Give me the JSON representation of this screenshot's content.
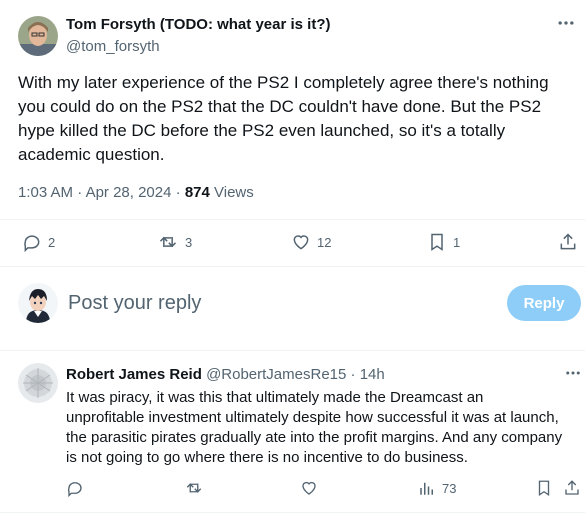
{
  "main_tweet": {
    "author_name": "Tom Forsyth (TODO: what year is it?)",
    "author_handle": "@tom_forsyth",
    "text_lines": [
      "With my later experience of the PS2 I completely agree there's nothing",
      "you could do on the PS2 that the DC couldn't have done. But the PS2",
      "hype killed the DC before the PS2 even launched, so it's a totally",
      "academic question."
    ],
    "time": "1:03 AM",
    "date": "Apr 28, 2024",
    "views_count": "874",
    "views_label": "Views",
    "separator": "·",
    "actions": {
      "replies": "2",
      "retweets": "3",
      "likes": "12",
      "bookmarks": "1"
    }
  },
  "composer": {
    "placeholder": "Post your reply",
    "button_label": "Reply"
  },
  "reply_tweet": {
    "author_name": "Robert James Reid",
    "author_handle": "@RobertJamesRe15",
    "separator": "·",
    "time": "14h",
    "text_lines": [
      "It was piracy, it was this that ultimately made the Dreamcast an",
      "unprofitable investment ultimately despite how successful it was at launch,",
      "the parasitic pirates gradually ate into the profit margins. And any company",
      "is not going to go where there is no incentive to do business."
    ],
    "views": "73"
  },
  "icons": [
    "more-icon",
    "reply-icon",
    "retweet-icon",
    "like-icon",
    "bookmark-icon",
    "share-icon",
    "analytics-icon"
  ],
  "colors": {
    "accent": "#1d9bf0",
    "reply_button_disabled": "#8ecdf8",
    "muted": "#536471"
  }
}
